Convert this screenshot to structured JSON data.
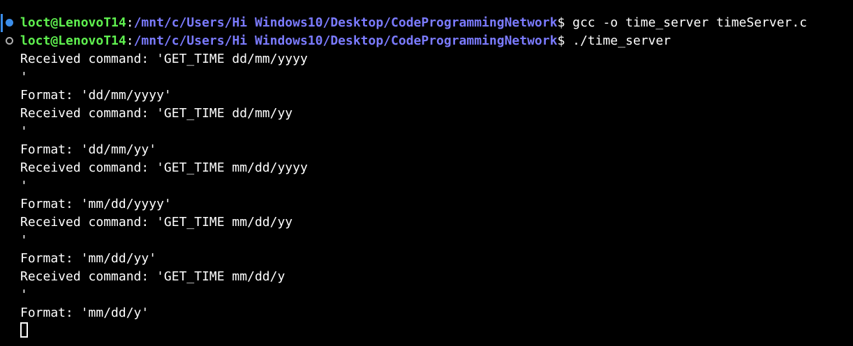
{
  "prompt": {
    "user": "loct@LenovoT14",
    "path": "/mnt/c/Users/Hi Windows10/Desktop/CodeProgrammingNetwork",
    "symbol": "$"
  },
  "commands": [
    " gcc -o time_server timeServer.c",
    " ./time_server"
  ],
  "output": [
    "Received command: 'GET_TIME dd/mm/yyyy",
    "'",
    "Format: 'dd/mm/yyyy'",
    "Received command: 'GET_TIME dd/mm/yy",
    "'",
    "Format: 'dd/mm/yy'",
    "Received command: 'GET_TIME mm/dd/yyyy",
    "'",
    "Format: 'mm/dd/yyyy'",
    "Received command: 'GET_TIME mm/dd/yy",
    "'",
    "Format: 'mm/dd/yy'",
    "Received command: 'GET_TIME mm/dd/y",
    "'",
    "Format: 'mm/dd/y'"
  ],
  "colors": {
    "background": "#000000",
    "user": "#5ff04f",
    "path": "#7b7bff",
    "text": "#ffffff",
    "decoration_success": "#3b8eea"
  }
}
